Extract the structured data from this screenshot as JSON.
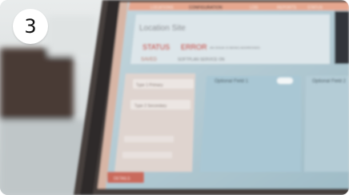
{
  "badge": {
    "number": "3"
  },
  "screen": {
    "tabs": [
      "LOCATIONS",
      "CONFIGURATION",
      "LOG",
      "REPORTS",
      "STATUS"
    ],
    "location_title": "Location Site",
    "status_label": "STATUS",
    "status_value": "ERROR",
    "status_detail": "AN ISSUE IS BEING ADDRESSED",
    "saved_label": "SAVED",
    "saved_detail": "SOFTPLAN SERVICE ON",
    "type_1": "Type 1 Primary",
    "type_2": "Type 2 Secondary",
    "optional_field_1": "Optional Field 1",
    "optional_field_2": "Optional Field 2",
    "action_button": "DETAILS"
  },
  "colors": {
    "error_red": "#c4433b",
    "panel_blue": "#a9c7d4",
    "screen_bg": "#bcd0d8"
  }
}
